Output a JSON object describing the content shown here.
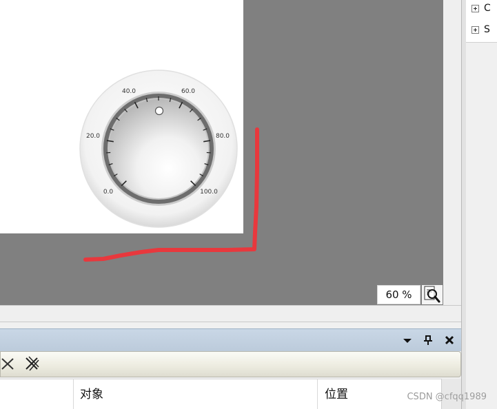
{
  "tree": {
    "items": [
      {
        "label": "C"
      },
      {
        "label": "S"
      }
    ]
  },
  "dial": {
    "ticks": [
      "0.0",
      "20.0",
      "40.0",
      "60.0",
      "80.0",
      "100.0"
    ]
  },
  "zoom": {
    "value": "60 %"
  },
  "grid": {
    "columns": [
      "对象",
      "位置"
    ]
  },
  "watermark": "CSDN @cfqq1989",
  "colors": {
    "canvas_bg": "#808080",
    "annotation_red": "#e8383d",
    "panel_header": "#c3d1e0"
  }
}
